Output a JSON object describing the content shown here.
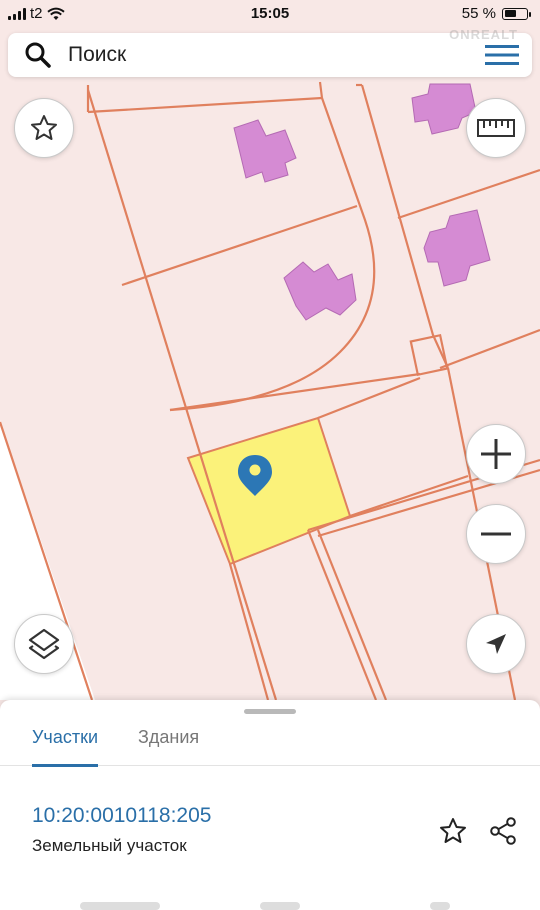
{
  "status_bar": {
    "carrier": "t2",
    "time": "15:05",
    "battery": "55 %",
    "battery_level": 0.55,
    "icons": [
      "signal-icon",
      "wifi-icon",
      "battery-icon"
    ]
  },
  "search": {
    "placeholder": "Поиск",
    "watermark": "ONREALT"
  },
  "map": {
    "background": "#f8e8e6",
    "boundary_color": "#e0805e",
    "building_color": "#d58bd3",
    "selected_parcel_color": "#fbf27a",
    "pin_color": "#2c77b5",
    "controls": [
      "favorite-star-icon",
      "ruler-icon",
      "zoom-in-icon",
      "zoom-out-icon",
      "layers-icon",
      "locate-arrow-icon"
    ]
  },
  "bottom_sheet": {
    "tabs": [
      {
        "label": "Участки",
        "active": true
      },
      {
        "label": "Здания",
        "active": false
      }
    ],
    "parcel": {
      "cadastral_number": "10:20:0010118:205",
      "type": "Земельный участок"
    },
    "accent_color": "#2a6fa8"
  }
}
